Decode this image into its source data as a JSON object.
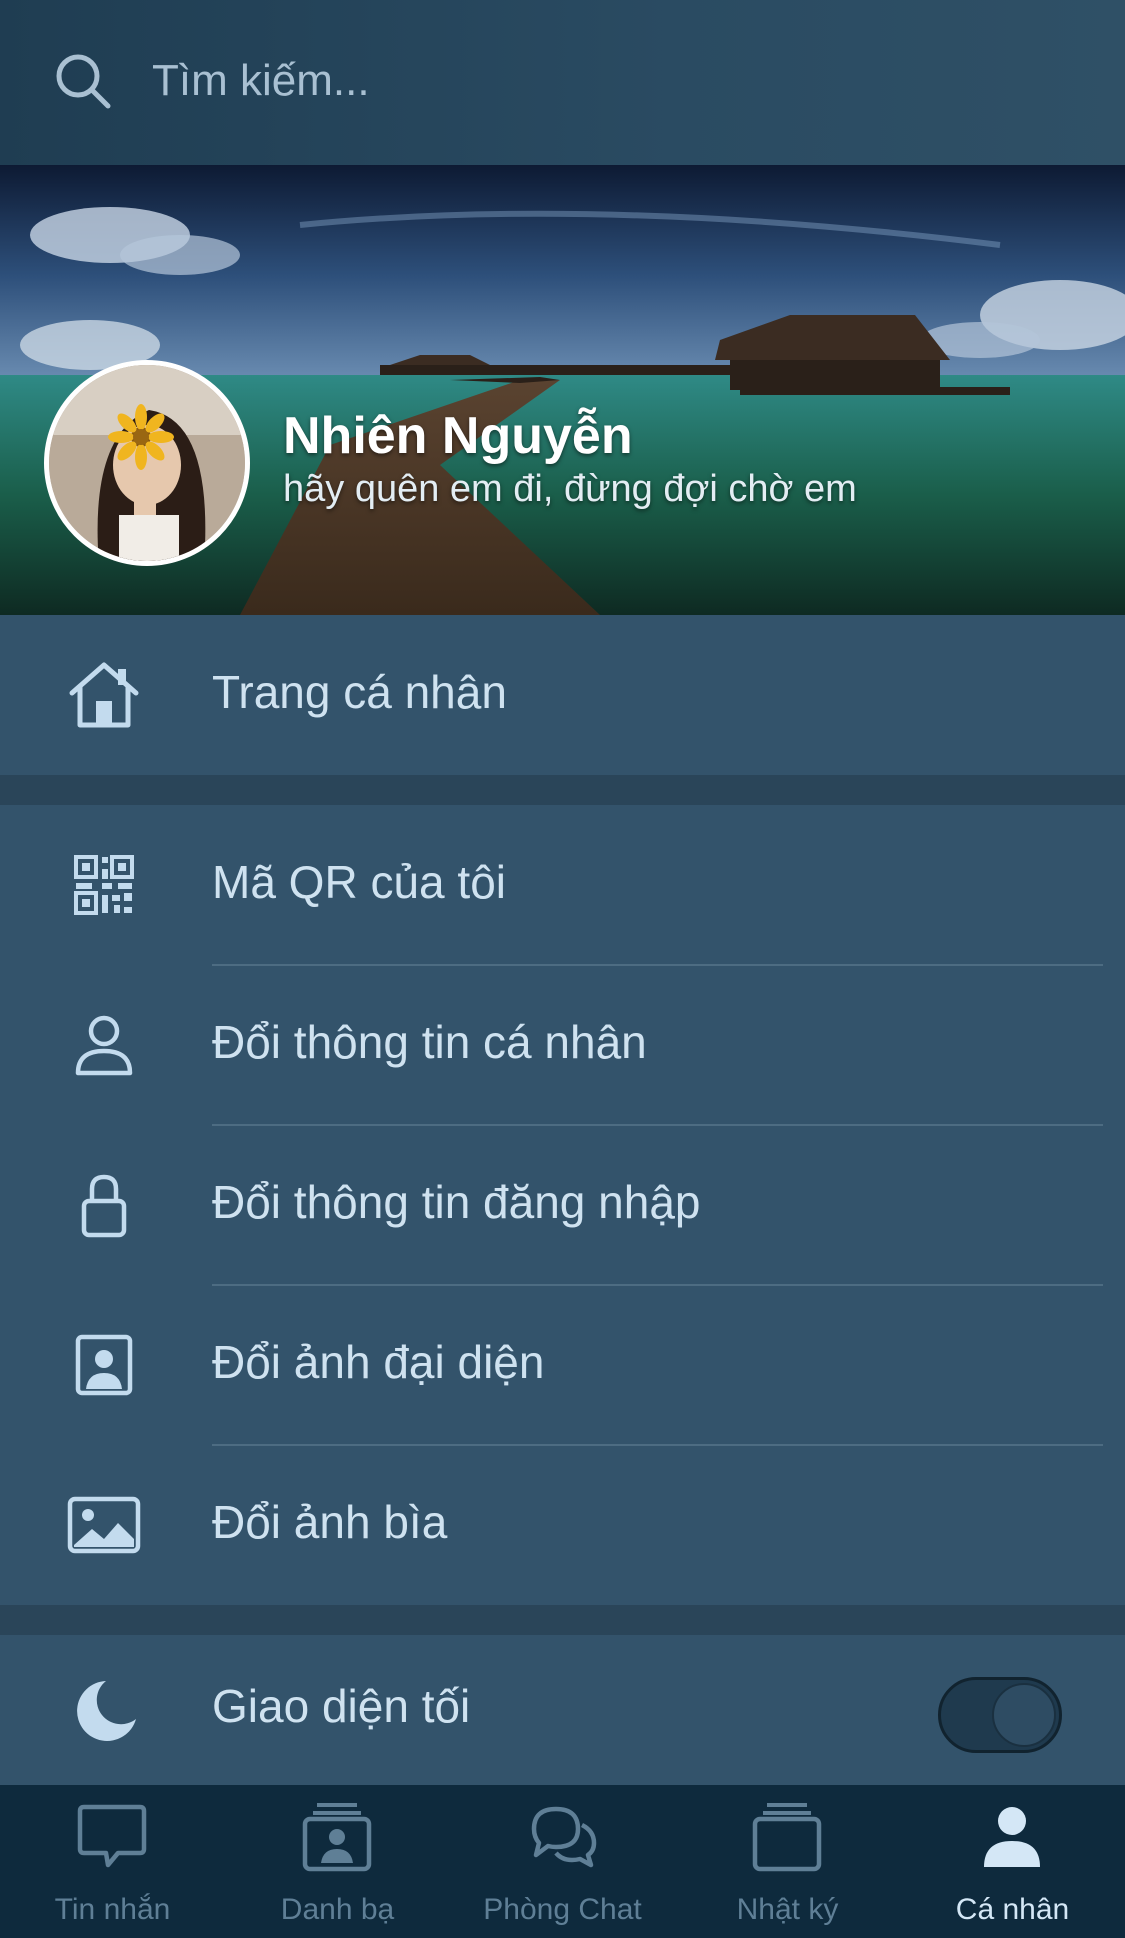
{
  "search": {
    "placeholder": "Tìm kiếm..."
  },
  "profile": {
    "name": "Nhiên Nguyễn",
    "status": "hãy quên em đi, đừng đợi chờ em"
  },
  "menu": {
    "profile_page": {
      "label": "Trang cá nhân",
      "icon": "home-icon"
    },
    "items": [
      {
        "label": "Mã QR của tôi",
        "icon": "qr-code-icon"
      },
      {
        "label": "Đổi thông tin cá nhân",
        "icon": "user-icon"
      },
      {
        "label": "Đổi thông tin đăng nhập",
        "icon": "lock-icon"
      },
      {
        "label": "Đổi ảnh đại diện",
        "icon": "portrait-icon"
      },
      {
        "label": "Đổi ảnh bìa",
        "icon": "image-icon"
      }
    ],
    "dark_mode": {
      "label": "Giao diện tối",
      "icon": "moon-icon",
      "enabled": false
    }
  },
  "tabs": [
    {
      "label": "Tin nhắn",
      "icon": "chat-bubble-icon",
      "active": false
    },
    {
      "label": "Danh bạ",
      "icon": "contacts-icon",
      "active": false
    },
    {
      "label": "Phòng Chat",
      "icon": "chat-room-icon",
      "active": false
    },
    {
      "label": "Nhật ký",
      "icon": "journal-icon",
      "active": false
    },
    {
      "label": "Cá nhân",
      "icon": "person-icon",
      "active": true
    }
  ],
  "colors": {
    "background": "#30536b",
    "tabbar": "#0e2a3d",
    "active_tab": "#d4e7f6",
    "inactive_tab": "#5f7f96"
  }
}
